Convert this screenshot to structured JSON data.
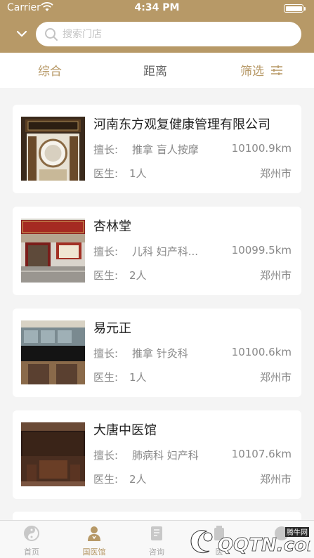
{
  "status_bar": {
    "carrier": "Carrier",
    "time": "4:34 PM"
  },
  "search": {
    "placeholder": "搜索门店"
  },
  "sort_tabs": [
    {
      "label": "综合",
      "active": true
    },
    {
      "label": "距离",
      "active": false
    },
    {
      "label": "筛选",
      "active": false
    }
  ],
  "stores": [
    {
      "name": "河南东方观复健康管理有限公司",
      "skill_label": "擅长:",
      "skills": "推拿 盲人按摩",
      "distance": "10100.9km",
      "doctor_label": "医生:",
      "doctors": "1人",
      "city": "郑州市"
    },
    {
      "name": "杏林堂",
      "skill_label": "擅长:",
      "skills": "儿科 妇产科...",
      "distance": "10099.5km",
      "doctor_label": "医生:",
      "doctors": "2人",
      "city": "郑州市"
    },
    {
      "name": "易元正",
      "skill_label": "擅长:",
      "skills": "推拿 针灸科",
      "distance": "10100.6km",
      "doctor_label": "医生:",
      "doctors": "1人",
      "city": "郑州市"
    },
    {
      "name": "大唐中医馆",
      "skill_label": "擅长:",
      "skills": "肺病科 妇产科",
      "distance": "10107.6km",
      "doctor_label": "医生:",
      "doctors": "2人",
      "city": "郑州市"
    }
  ],
  "tabbar": [
    {
      "label": "首页",
      "icon": "taiji-icon",
      "active": false
    },
    {
      "label": "国医馆",
      "icon": "doctor-icon",
      "active": true
    },
    {
      "label": "咨询",
      "icon": "document-icon",
      "active": false
    },
    {
      "label": "医",
      "icon": "medicine-icon",
      "active": false
    },
    {
      "label": "",
      "icon": "profile-icon",
      "active": false
    }
  ],
  "watermark": {
    "brand": "QQTN.com",
    "sub": "腾牛网"
  },
  "colors": {
    "accent": "#b79967",
    "background": "#f4f4f4"
  }
}
